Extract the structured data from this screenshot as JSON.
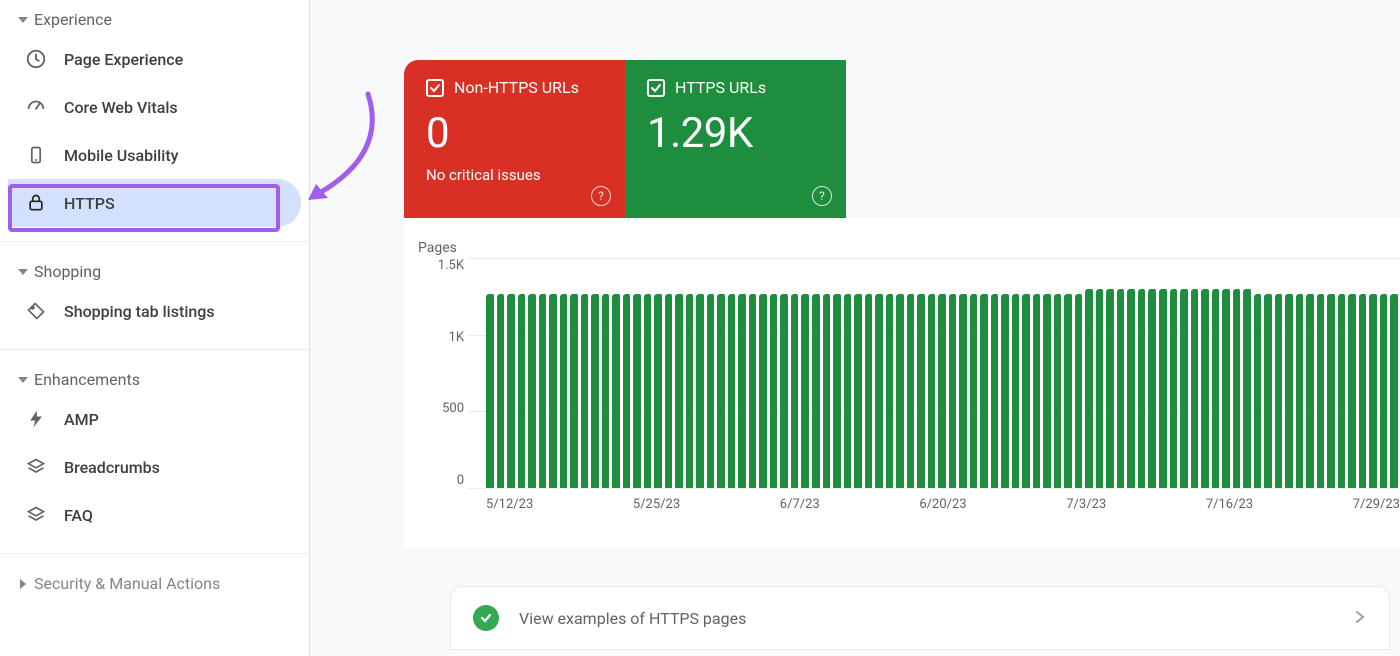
{
  "sidebar": {
    "sections": {
      "experience": {
        "title": "Experience",
        "items": [
          {
            "key": "page-experience",
            "label": "Page Experience"
          },
          {
            "key": "core-web-vitals",
            "label": "Core Web Vitals"
          },
          {
            "key": "mobile-usability",
            "label": "Mobile Usability"
          },
          {
            "key": "https",
            "label": "HTTPS",
            "selected": true
          }
        ]
      },
      "shopping": {
        "title": "Shopping",
        "items": [
          {
            "key": "shopping-tab-listings",
            "label": "Shopping tab listings"
          }
        ]
      },
      "enhancements": {
        "title": "Enhancements",
        "items": [
          {
            "key": "amp",
            "label": "AMP"
          },
          {
            "key": "breadcrumbs",
            "label": "Breadcrumbs"
          },
          {
            "key": "faq",
            "label": "FAQ"
          }
        ]
      },
      "security": {
        "title": "Security & Manual Actions"
      }
    }
  },
  "cards": {
    "non_https": {
      "title": "Non-HTTPS URLs",
      "value": "0",
      "subtext": "No critical issues"
    },
    "https": {
      "title": "HTTPS URLs",
      "value": "1.29K"
    }
  },
  "footer": {
    "view_examples": "View examples of HTTPS pages"
  },
  "chart_data": {
    "type": "bar",
    "ylabel": "Pages",
    "ylim": [
      0,
      1500
    ],
    "y_ticks": [
      "1.5K",
      "1K",
      "500",
      "0"
    ],
    "x_ticks": [
      "5/12/23",
      "5/25/23",
      "6/7/23",
      "6/20/23",
      "7/3/23",
      "7/16/23",
      "7/29/23"
    ],
    "n_bars": 87,
    "values_flat": 1265,
    "values_high_region": {
      "start": 57,
      "end": 72,
      "value": 1300
    }
  }
}
